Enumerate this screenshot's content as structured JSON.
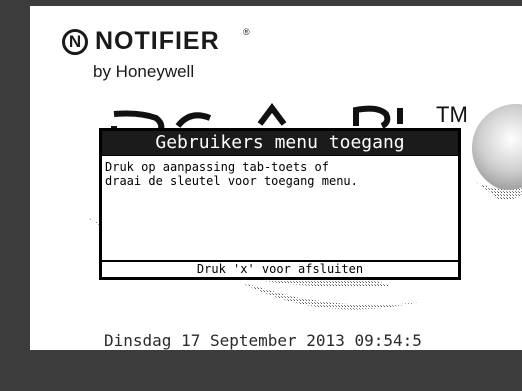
{
  "brand": {
    "logo_letter": "N",
    "name": "NOTIFIER",
    "registered": "®",
    "subtitle": "by Honeywell",
    "product_trademark": "TM"
  },
  "dialog": {
    "title": "Gebruikers menu toegang",
    "message_line1": "Druk op aanpassing tab-toets of",
    "message_line2": "draai de sleutel voor toegang menu.",
    "footer": "Druk 'x' voor afsluiten"
  },
  "status": {
    "datetime": "Dinsdag 17 September 2013 09:54:5"
  },
  "colors": {
    "frame": "#3c3c3c",
    "dialog_title_bg": "#1b1b1b",
    "screen_bg": "#ffffff"
  }
}
